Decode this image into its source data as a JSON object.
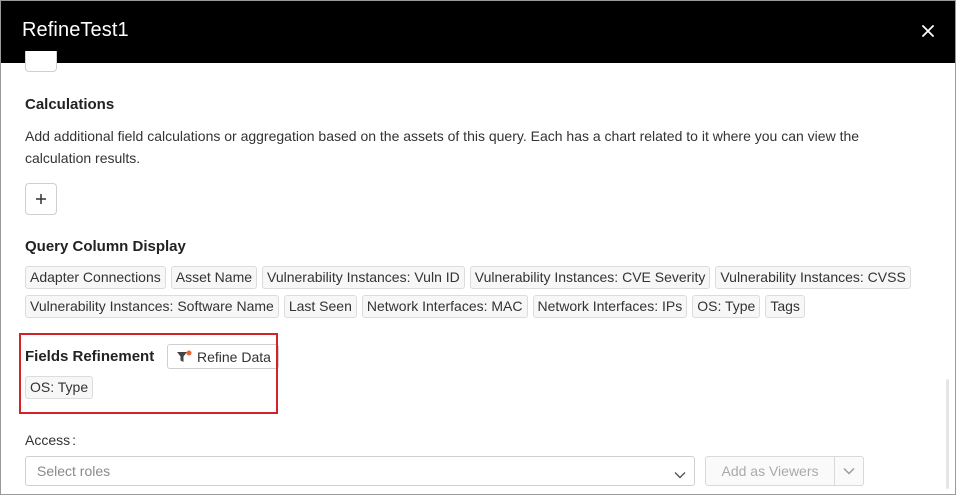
{
  "header": {
    "title": "RefineTest1",
    "close_icon": "close-icon"
  },
  "calculations": {
    "title": "Calculations",
    "description": "Add additional field calculations or aggregation based on the assets of this query. Each has a chart related to it where you can view the calculation results.",
    "add_label": "+"
  },
  "query_columns": {
    "title": "Query Column Display",
    "row1": [
      "Adapter Connections",
      "Asset Name",
      "Vulnerability Instances: Vuln ID",
      "Vulnerability Instances: CVE Severity",
      "Vulnerability Instances: CVSS"
    ],
    "row2": [
      "Vulnerability Instances: Software Name",
      "Last Seen",
      "Network Interfaces: MAC",
      "Network Interfaces: IPs",
      "OS: Type",
      "Tags"
    ]
  },
  "fields_refinement": {
    "title": "Fields Refinement",
    "refine_button": "Refine Data",
    "refine_icon": "funnel-icon",
    "tags": [
      "OS: Type"
    ],
    "highlight_color": "#d2232a"
  },
  "access": {
    "label": "Access",
    "colon": ":",
    "select_placeholder": "Select roles",
    "viewers_button": "Add as Viewers"
  }
}
